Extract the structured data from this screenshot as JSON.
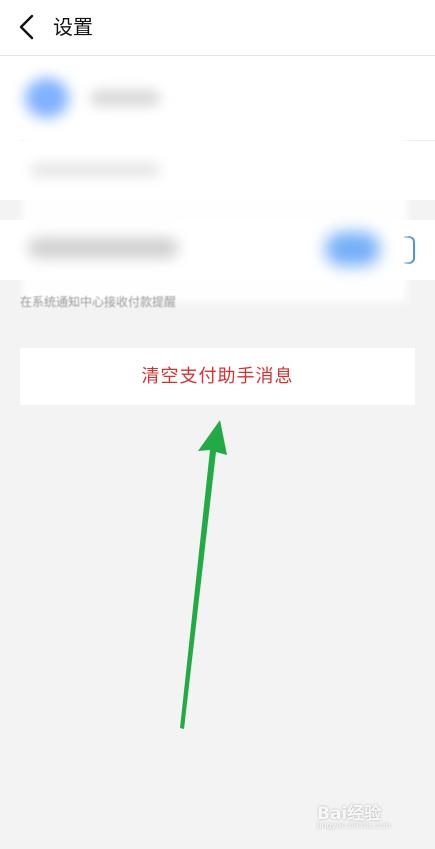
{
  "header": {
    "back_icon": "chevron-left-icon",
    "title": "设置"
  },
  "notification_hint": "在系统通知中心接收付款提醒",
  "clear_button": {
    "label": "清空支付助手消息"
  },
  "annotation": {
    "arrow_icon": "green-arrow-up-icon",
    "color": "#22aa44"
  },
  "watermark": {
    "brand": "Bai经验",
    "url": "jingyan.baidu.com"
  },
  "colors": {
    "accent_blue": "#4a8ee8",
    "danger_red": "#d63030",
    "background": "#f3f3f3"
  }
}
